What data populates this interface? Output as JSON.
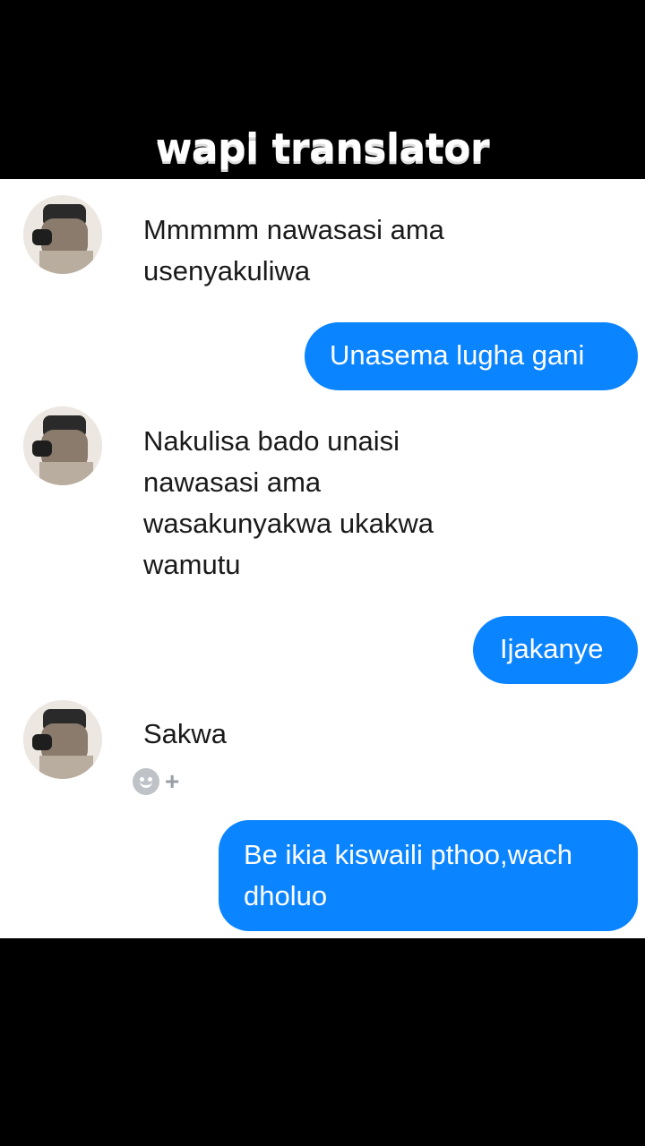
{
  "caption": "wapi translator",
  "chat": {
    "messages": [
      {
        "direction": "incoming",
        "text": "Mmmmm nawasasi ama usenyakuliwa"
      },
      {
        "direction": "outgoing",
        "text": "Unasema lugha gani"
      },
      {
        "direction": "incoming",
        "text": "Nakulisa bado unaisi nawasasi ama wasakunyakwa ukakwa wamutu"
      },
      {
        "direction": "outgoing",
        "text": "Ijakanye"
      },
      {
        "direction": "incoming",
        "text": "Sakwa"
      },
      {
        "direction": "outgoing",
        "text": "Be ikia kiswaili pthoo,wach dholuo"
      }
    ],
    "reaction": {
      "icon": "smiley-add-icon",
      "plus": "+"
    },
    "colors": {
      "outgoing_bubble": "#0b84ff",
      "background": "#ffffff"
    }
  }
}
